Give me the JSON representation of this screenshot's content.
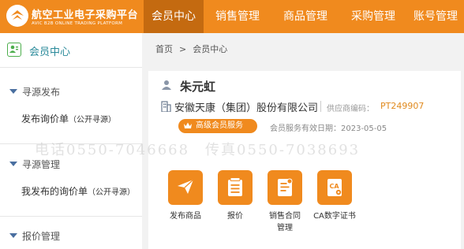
{
  "header": {
    "logo_title": "航空工业电子采购平台",
    "logo_subtitle": "AVIC B2B ONLINE TRADING PLATFORM",
    "nav": [
      {
        "label": "会员中心",
        "active": true
      },
      {
        "label": "销售管理",
        "active": false
      },
      {
        "label": "商品管理",
        "active": false
      },
      {
        "label": "采购管理",
        "active": false
      },
      {
        "label": "账号管理",
        "active": false
      }
    ]
  },
  "sidebar": {
    "title": "会员中心",
    "sections": [
      {
        "title": "寻源发布",
        "link": "发布询价单",
        "link_note": "（公开寻源）"
      },
      {
        "title": "寻源管理",
        "link": "我发布的询价单",
        "link_note": "（公开寻源）"
      },
      {
        "title": "报价管理"
      }
    ]
  },
  "breadcrumb": {
    "home": "首页",
    "separator": ">",
    "current": "会员中心"
  },
  "profile": {
    "user_name": "朱元虹",
    "company": "安徽天康（集团）股份有限公司",
    "supplier_label": "供应商编码：",
    "supplier_code": "PT249907",
    "badge": "高级会员服务",
    "expiry": "会员服务有效日期：2023-05-05"
  },
  "watermark": "电话0550-7046668　传真0550-7038693",
  "tiles": [
    {
      "label": "发布商品",
      "icon": "paper-plane-icon"
    },
    {
      "label": "报价",
      "icon": "document-list-icon"
    },
    {
      "label": "销售合同",
      "label2": "管理",
      "icon": "contract-icon"
    },
    {
      "label": "CA数字证书",
      "icon": "ca-certificate-icon"
    }
  ],
  "colors": {
    "brand": "#f08a1e",
    "nav_active": "#c46a10",
    "sidebar_title": "#2a8a9a",
    "accent_blue": "#4a6fa0"
  }
}
